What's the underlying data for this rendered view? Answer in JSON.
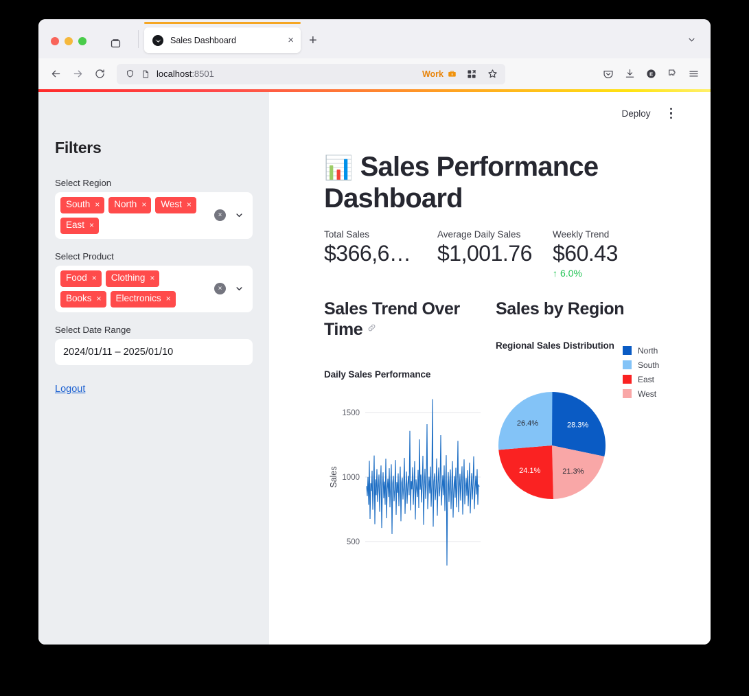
{
  "browser": {
    "tab": {
      "title": "Sales Dashboard",
      "favicon": "streamlit-favicon",
      "close_label": "×"
    },
    "new_tab_label": "+",
    "url": {
      "host": "localhost",
      "port": ":8501"
    },
    "work_profile_label": "Work",
    "icons": {
      "back": "back-arrow-icon",
      "forward": "forward-arrow-icon",
      "reload": "reload-icon",
      "shield": "shield-icon",
      "page": "page-icon",
      "briefcase": "briefcase-icon",
      "extensions_grid": "extensions-grid-icon",
      "bookmark": "star-icon",
      "pocket": "pocket-icon",
      "downloads": "download-icon",
      "account": "account-icon",
      "extension": "extension-puzzle-icon",
      "menu": "hamburger-menu-icon",
      "tab_list": "tab-list-icon",
      "tabs_chevron": "chevron-down-icon"
    }
  },
  "sidebar": {
    "title": "Filters",
    "region": {
      "label": "Select Region",
      "chips": [
        "South",
        "North",
        "West",
        "East"
      ]
    },
    "product": {
      "label": "Select Product",
      "chips": [
        "Food",
        "Clothing",
        "Books",
        "Electronics"
      ]
    },
    "date_range": {
      "label": "Select Date Range",
      "value": "2024/01/11 – 2025/01/10"
    },
    "logout_label": "Logout",
    "chip_remove_label": "×",
    "clear_label": "×"
  },
  "main": {
    "toolbar": {
      "deploy_label": "Deploy",
      "menu_label": "kebab-menu-icon"
    },
    "title_emoji": "📊",
    "title": "Sales Performance Dashboard",
    "metrics": [
      {
        "label": "Total Sales",
        "value": "$366,6…",
        "delta": ""
      },
      {
        "label": "Average Daily Sales",
        "value": "$1,001.76",
        "delta": ""
      },
      {
        "label": "Weekly Trend",
        "value": "$60.43",
        "delta": "6.0%",
        "delta_arrow": "↑",
        "delta_color": "#21c354"
      }
    ],
    "sections": {
      "trend": {
        "header": "Sales Trend Over Time",
        "anchor_icon": "link-icon"
      },
      "region": {
        "header": "Sales by Region"
      }
    }
  },
  "chart_data": [
    {
      "type": "line",
      "title": "Daily Sales Performance",
      "xlabel": "",
      "ylabel": "Sales",
      "ylim": [
        300,
        1800
      ],
      "yticks": [
        500,
        1000,
        1500
      ],
      "grid": true,
      "line_color": "#1f6fc4",
      "mean": 1001.76,
      "note": "Daily noisy series oscillating around 1000 with spikes to ~1750 and dips to ~380",
      "values": [
        1035,
        952,
        1110,
        880,
        1243,
        764,
        1058,
        995,
        1162,
        840,
        1015,
        1287,
        720,
        1090,
        960,
        1175,
        905,
        1020,
        1130,
        823,
        1042,
        1205,
        690,
        1005,
        1148,
        935,
        1072,
        880,
        1260,
        770,
        1008,
        1096,
        945,
        1182,
        860,
        1030,
        1215,
        640,
        1055,
        1120,
        910,
        1005,
        1250,
        798,
        1068,
        980,
        1140,
        870,
        1025,
        1196,
        745,
        1060,
        1105,
        925,
        1038,
        1268,
        805,
        1012,
        1155,
        890,
        1048,
        1120,
        960,
        1490,
        835,
        1075,
        1008,
        1190,
        880,
        1035,
        1240,
        760,
        1090,
        1015,
        945,
        1168,
        855,
        1420,
        1005,
        1130,
        900,
        1050,
        1285,
        715,
        1022,
        1178,
        930,
        1060,
        1545,
        845,
        1008,
        1112,
        975,
        1196,
        865,
        1040,
        1752,
        700,
        1068,
        1140,
        920,
        1015,
        1262,
        790,
        1055,
        1188,
        950,
        1030,
        1455,
        875,
        1008,
        1124,
        960,
        1205,
        830,
        1045,
        1290,
        380,
        1012,
        1150,
        905,
        1062,
        1172,
        845,
        1030,
        1240,
        775,
        1008,
        1118,
        940,
        1186,
        860,
        1052,
        1408,
        820,
        1025,
        1136,
        915,
        1070,
        1198,
        800,
        1040,
        1255,
        885,
        1018,
        1102,
        955,
        1165,
        870,
        1035,
        1228,
        810,
        1008,
        1142,
        925,
        1055,
        1280,
        845,
        1012,
        1120,
        965,
        1175,
        880,
        1048,
        1030
      ]
    },
    {
      "type": "pie",
      "title": "Regional Sales Distribution",
      "labels": [
        "North",
        "South",
        "East",
        "West"
      ],
      "percentages": [
        28.3,
        26.4,
        24.1,
        21.3
      ],
      "colors": [
        "#0a5bc4",
        "#83c3f7",
        "#fa2222",
        "#f9a7a7"
      ],
      "legend_position": "right",
      "slice_order_clockwise_from_top": [
        "North",
        "West",
        "East",
        "South"
      ],
      "pct_labels": [
        "28.3%",
        "26.4%",
        "24.1%",
        "21.3%"
      ]
    }
  ]
}
